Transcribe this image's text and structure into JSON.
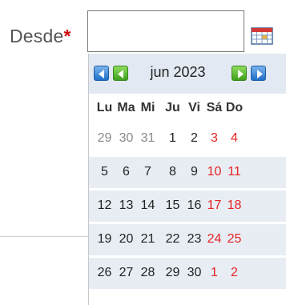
{
  "form": {
    "label": "Desde",
    "required_mark": "*",
    "value": "",
    "placeholder": ""
  },
  "icons": {
    "calendar": "calendar-icon",
    "prev_year": "double-arrow-left-icon",
    "prev_month": "arrow-left-icon",
    "next_month": "arrow-right-icon",
    "next_year": "double-arrow-right-icon"
  },
  "colors": {
    "header_bg": "#e3e9f2",
    "weekend": "#e52222",
    "other_month": "#8a8a8a",
    "nav_blue": "#1f6fc8",
    "nav_green": "#3e9f1c"
  },
  "calendar": {
    "month_label": "jun 2023",
    "weekdays": [
      "Lu",
      "Ma",
      "Mi",
      "Ju",
      "Vi",
      "Sá",
      "Do"
    ],
    "weeks": [
      [
        "29",
        "30",
        "31",
        "1",
        "2",
        "3",
        "4"
      ],
      [
        "5",
        "6",
        "7",
        "8",
        "9",
        "10",
        "11"
      ],
      [
        "12",
        "13",
        "14",
        "15",
        "16",
        "17",
        "18"
      ],
      [
        "19",
        "20",
        "21",
        "22",
        "23",
        "24",
        "25"
      ],
      [
        "26",
        "27",
        "28",
        "29",
        "30",
        "1",
        "2"
      ]
    ],
    "other_month_first_row": 3,
    "other_month_last_row_from": 5
  }
}
